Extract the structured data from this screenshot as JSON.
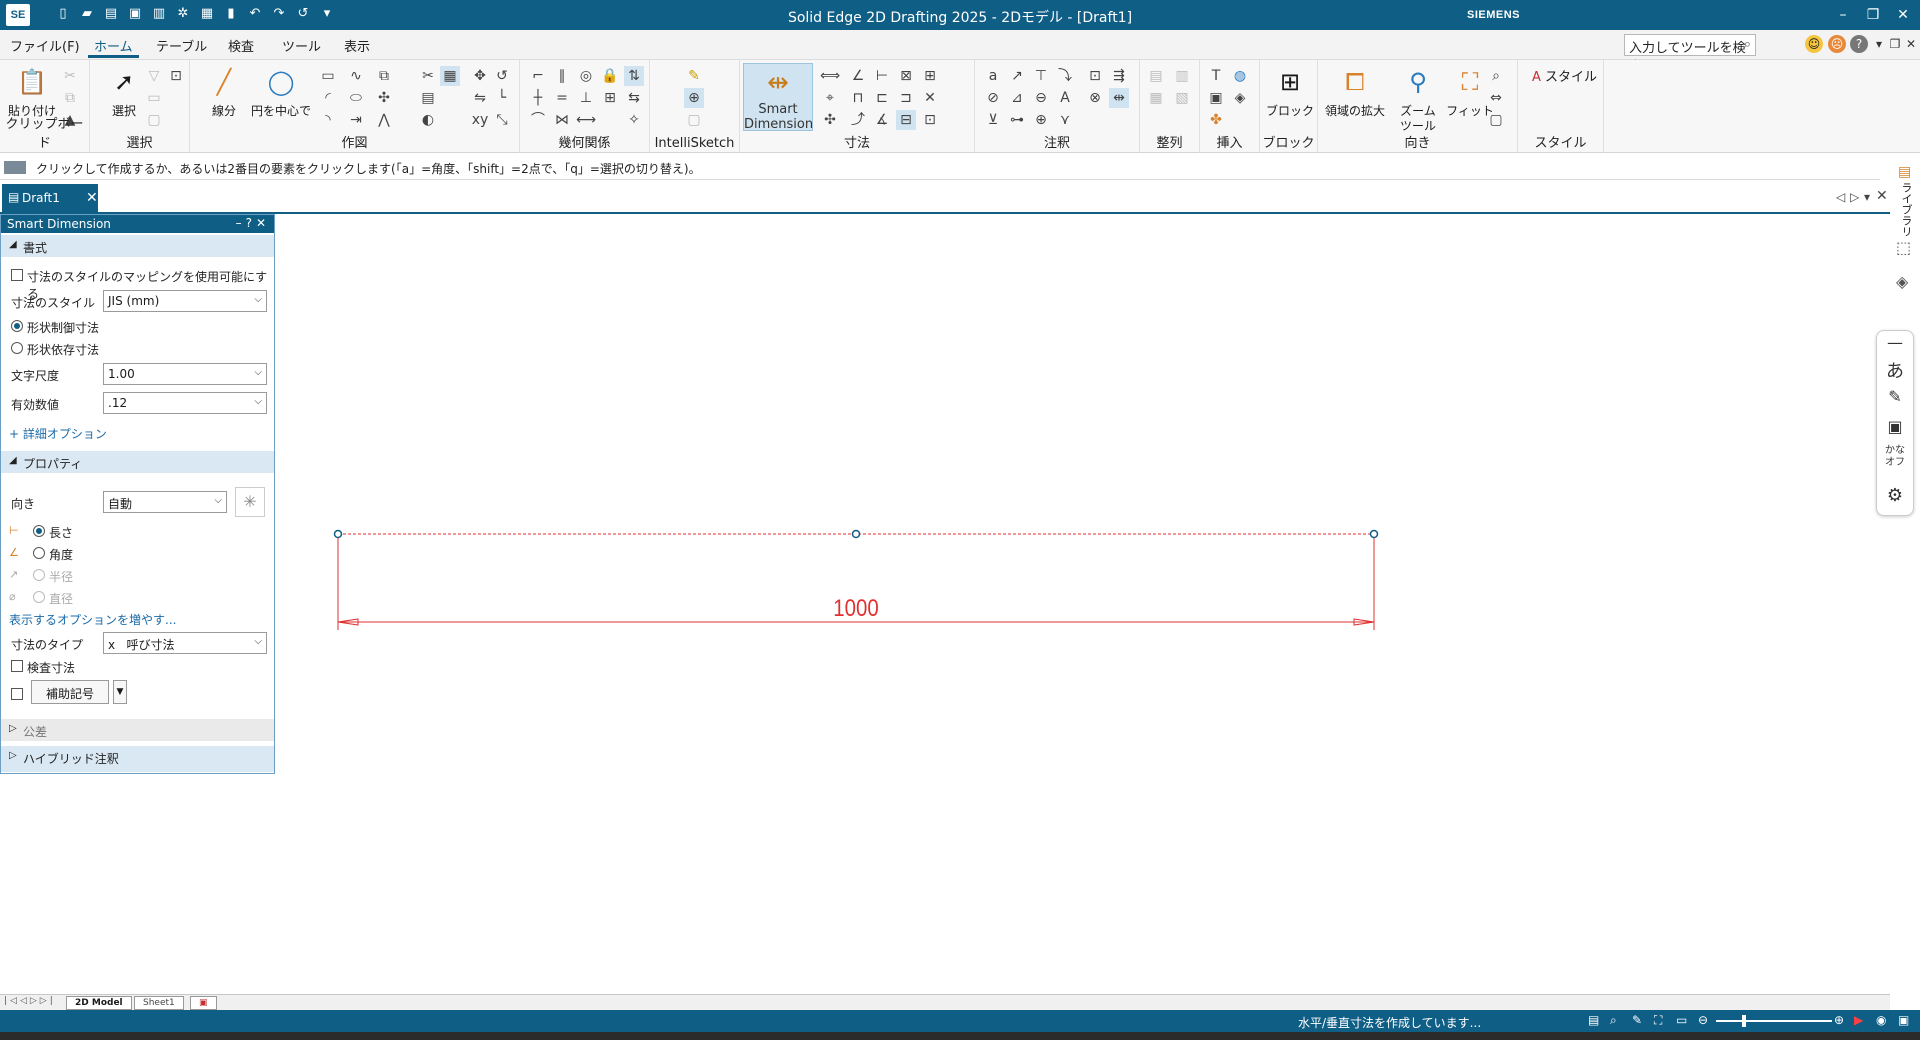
{
  "app": {
    "logo": "SE",
    "title": "Solid Edge 2D Drafting 2025 - 2Dモデル - [Draft1]",
    "brand": "SIEMENS",
    "search_placeholder": "入力してツールを検索"
  },
  "menu": {
    "tabs": [
      "ファイル(F)",
      "ホーム",
      "テーブル",
      "検査",
      "ツール",
      "表示"
    ],
    "active": "ホーム"
  },
  "ribbon": {
    "clipboard": {
      "paste": "貼り付け",
      "label": "クリップボード"
    },
    "select": {
      "button": "選択",
      "label": "選択"
    },
    "draw": {
      "line": "線分",
      "circle": "円を中心で",
      "label": "作図"
    },
    "relations": {
      "label": "幾何関係"
    },
    "intellisketch": {
      "label": "IntelliSketch"
    },
    "dimension": {
      "smart_line1": "Smart",
      "smart_line2": "Dimension",
      "label": "寸法"
    },
    "annotation": {
      "label": "注釈"
    },
    "align": {
      "label": "整列"
    },
    "insert": {
      "label": "挿入"
    },
    "block": {
      "button": "ブロック",
      "label": "ブロック"
    },
    "orient": {
      "zoom_area": "領域の拡大",
      "zoom_tool_1": "ズーム",
      "zoom_tool_2": "ツール",
      "fit": "フィット",
      "label": "向き"
    },
    "style": {
      "button": "スタイル",
      "label": "スタイル"
    }
  },
  "prompt": "クリックして作成するか、あるいは2番目の要素をクリックします(「a」=角度、「shift」=2点で、「q」=選択の切り替え)。",
  "doc_tab": "Draft1",
  "panel": {
    "title": "Smart Dimension",
    "format_header": "書式",
    "enable_mapping": "寸法のスタイルのマッピングを使用可能にする",
    "dim_style_label": "寸法のスタイル",
    "dim_style_value": "JIS (mm)",
    "driving": "形状制御寸法",
    "driven": "形状依存寸法",
    "text_scale_label": "文字尺度",
    "text_scale_value": "1.00",
    "precision_label": "有効数値",
    "precision_value": ".12",
    "detail_options": "+ 詳細オプション",
    "props_header": "プロパティ",
    "orient_label": "向き",
    "orient_value": "自動",
    "length": "長さ",
    "angle": "角度",
    "radius": "半径",
    "diameter": "直径",
    "more_options": "表示するオプションを増やす...",
    "dim_type_label": "寸法のタイプ",
    "dim_type_value": "x   呼び寸法",
    "inspection": "検査寸法",
    "aux_symbol": "補助記号",
    "tolerance": "公差",
    "hybrid": "ハイブリッド注釈"
  },
  "canvas": {
    "dimension_text": "1000"
  },
  "right_rail": {
    "library": "ライブラリ",
    "kana_a": "あ",
    "kana_off_1": "かな",
    "kana_off_2": "オフ"
  },
  "sheets": [
    "2D Model",
    "Sheet1"
  ],
  "status": "水平/垂直寸法を作成しています...",
  "colors": {
    "accent": "#0f5e85",
    "dimension": "#e02020",
    "selection": "#0f5e85"
  }
}
